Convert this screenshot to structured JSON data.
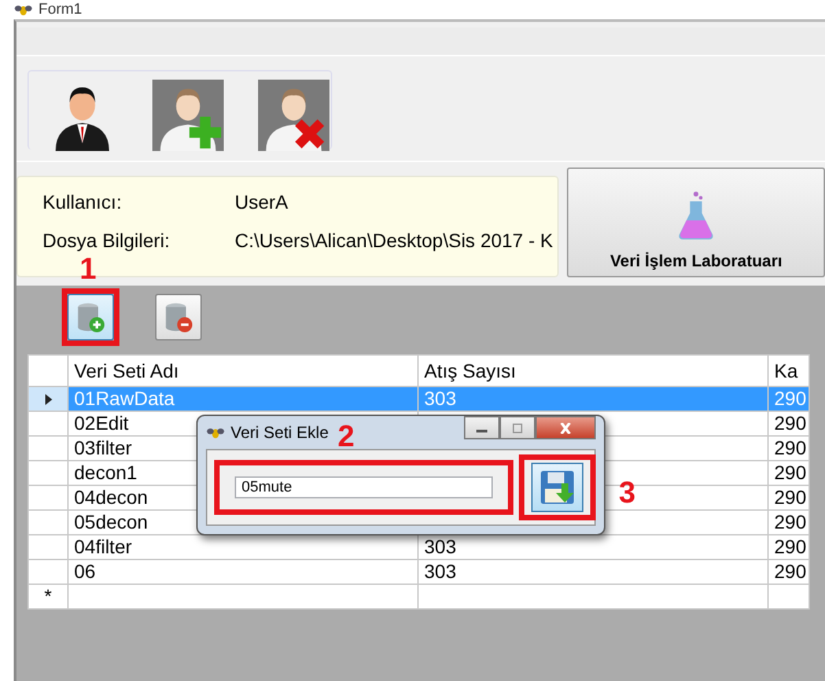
{
  "window": {
    "title": "Form1"
  },
  "user_tools": [
    {
      "kind": "user"
    },
    {
      "kind": "add-user"
    },
    {
      "kind": "remove-user"
    }
  ],
  "info": [
    {
      "label": "Kullanıcı:",
      "value": "UserA"
    },
    {
      "label": "Dosya Bilgileri:",
      "value": "C:\\Users\\Alican\\Desktop\\Sis 2017 - K"
    }
  ],
  "lab_button": {
    "label": "Veri İşlem Laboratuarı"
  },
  "dataset_tools": [
    {
      "kind": "add",
      "callout": "1"
    },
    {
      "kind": "remove"
    }
  ],
  "table": {
    "columns": [
      "Veri Seti Adı",
      "Atış Sayısı",
      "Ka"
    ],
    "rows": [
      {
        "selected": true,
        "cells": [
          "01RawData",
          "303",
          "290"
        ]
      },
      {
        "selected": false,
        "cells": [
          "02Edit",
          null,
          "290"
        ]
      },
      {
        "selected": false,
        "cells": [
          "03filter",
          null,
          "290"
        ]
      },
      {
        "selected": false,
        "cells": [
          "decon1",
          null,
          "290"
        ]
      },
      {
        "selected": false,
        "cells": [
          "04decon",
          null,
          "290"
        ]
      },
      {
        "selected": false,
        "cells": [
          "05decon",
          null,
          "290"
        ]
      },
      {
        "selected": false,
        "cells": [
          "04filter",
          "303",
          "290"
        ]
      },
      {
        "selected": false,
        "cells": [
          "06",
          "303",
          "290"
        ]
      }
    ],
    "new_row_marker": "*"
  },
  "dialog": {
    "title": "Veri Seti Ekle",
    "title_callout": "2",
    "value": "05mute",
    "save_callout": "3"
  }
}
